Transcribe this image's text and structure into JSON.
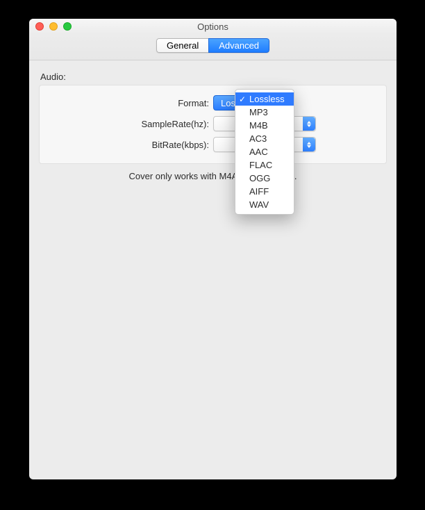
{
  "window": {
    "title": "Options"
  },
  "tabs": {
    "general": "General",
    "advanced": "Advanced"
  },
  "section": {
    "audio": "Audio:"
  },
  "labels": {
    "format": "Format:",
    "samplerate": "SampleRate(hz):",
    "bitrate": "BitRate(kbps):"
  },
  "values": {
    "format": "Lossless",
    "samplerate": "",
    "bitrate": ""
  },
  "hint": "Cover only works with M4A and MP3 files.",
  "formatMenu": {
    "items": [
      "Lossless",
      "MP3",
      "M4B",
      "AC3",
      "AAC",
      "FLAC",
      "OGG",
      "AIFF",
      "WAV"
    ],
    "selected": "Lossless"
  }
}
